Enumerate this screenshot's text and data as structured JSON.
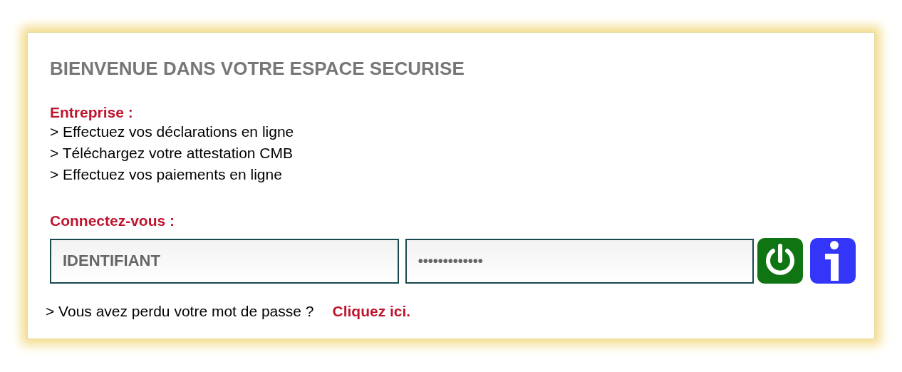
{
  "title": "BIENVENUE DANS VOTRE ESPACE SECURISE",
  "entreprise": {
    "heading": "Entreprise :",
    "items": [
      "> Effectuez vos déclarations en ligne",
      "> Téléchargez votre attestation CMB",
      "> Effectuez vos paiements en ligne"
    ]
  },
  "login": {
    "heading": "Connectez-vous :",
    "username": {
      "placeholder": "IDENTIFIANT"
    },
    "password": {
      "placeholder": "•••••••••••••"
    }
  },
  "forgot": {
    "text": "> Vous avez perdu votre mot de passe ?",
    "link": "Cliquez ici."
  }
}
